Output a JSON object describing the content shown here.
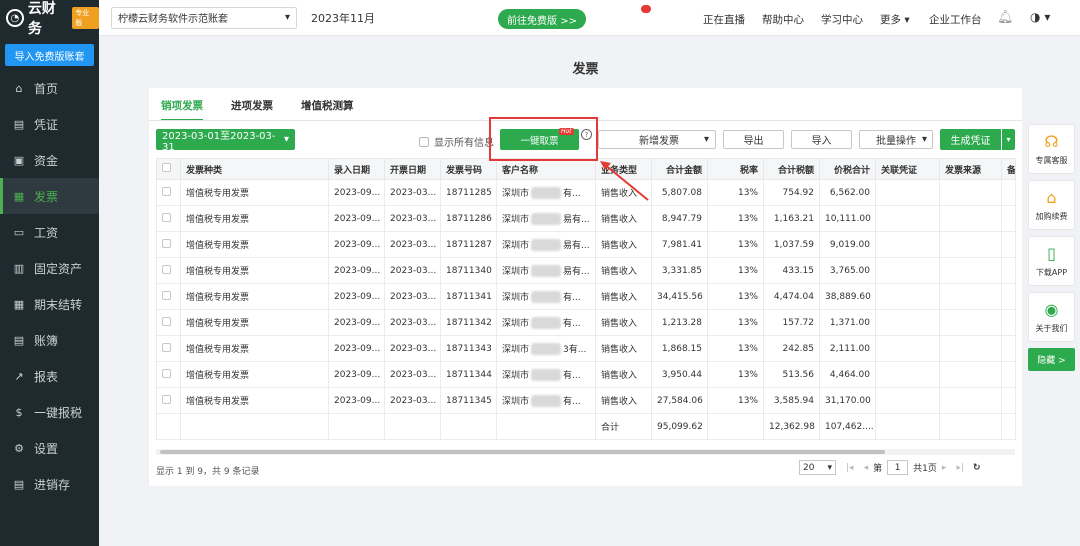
{
  "app": {
    "logo_text": "云财务",
    "edition_badge": "专业版"
  },
  "sidebar": {
    "import_button": "导入免费版账套",
    "items": [
      {
        "label": "首页",
        "icon": "home-icon",
        "glyph": "⌂",
        "active": false
      },
      {
        "label": "凭证",
        "icon": "voucher-icon",
        "glyph": "▤",
        "active": false
      },
      {
        "label": "资金",
        "icon": "fund-icon",
        "glyph": "▣",
        "active": false
      },
      {
        "label": "发票",
        "icon": "invoice-icon",
        "glyph": "▦",
        "active": true
      },
      {
        "label": "工资",
        "icon": "salary-icon",
        "glyph": "▭",
        "active": false
      },
      {
        "label": "固定资产",
        "icon": "asset-icon",
        "glyph": "▥",
        "active": false
      },
      {
        "label": "期末结转",
        "icon": "period-end-icon",
        "glyph": "▦",
        "active": false
      },
      {
        "label": "账簿",
        "icon": "ledger-icon",
        "glyph": "▤",
        "active": false
      },
      {
        "label": "报表",
        "icon": "report-icon",
        "glyph": "↗",
        "active": false
      },
      {
        "label": "一键报税",
        "icon": "tax-icon",
        "glyph": "$",
        "active": false
      },
      {
        "label": "设置",
        "icon": "settings-icon",
        "glyph": "⚙",
        "active": false
      },
      {
        "label": "进销存",
        "icon": "inventory-icon",
        "glyph": "▤",
        "active": false
      }
    ]
  },
  "topbar": {
    "account": "柠檬云财务软件示范账套",
    "period": "2023年11月",
    "free_button": "前往免费版 >>",
    "links": [
      "正在直播",
      "帮助中心",
      "学习中心",
      "更多",
      "企业工作台"
    ]
  },
  "page": {
    "title": "发票"
  },
  "tabs": [
    "销项发票",
    "进项发票",
    "增值税测算"
  ],
  "toolbar": {
    "date_range": "2023-03-01至2023-03-31",
    "show_all": "显示所有信息",
    "fetch_button": "一键取票",
    "hot_badge": "Hot",
    "new_invoice": "新增发票",
    "export": "导出",
    "import": "导入",
    "batch": "批量操作",
    "generate": "生成凭证"
  },
  "table": {
    "columns": [
      "发票种类",
      "录入日期",
      "开票日期",
      "发票号码",
      "客户名称",
      "业务类型",
      "合计金额",
      "税率",
      "合计税额",
      "价税合计",
      "关联凭证",
      "发票来源",
      "备"
    ],
    "rows": [
      [
        "增值税专用发票",
        "2023-09...",
        "2023-03...",
        "18711285",
        "深圳市",
        "有...",
        "销售收入",
        "5,807.08",
        "13%",
        "754.92",
        "6,562.00"
      ],
      [
        "增值税专用发票",
        "2023-09...",
        "2023-03...",
        "18711286",
        "深圳市",
        "易有...",
        "销售收入",
        "8,947.79",
        "13%",
        "1,163.21",
        "10,111.00"
      ],
      [
        "增值税专用发票",
        "2023-09...",
        "2023-03...",
        "18711287",
        "深圳市",
        "易有...",
        "销售收入",
        "7,981.41",
        "13%",
        "1,037.59",
        "9,019.00"
      ],
      [
        "增值税专用发票",
        "2023-09...",
        "2023-03...",
        "18711340",
        "深圳市",
        "易有...",
        "销售收入",
        "3,331.85",
        "13%",
        "433.15",
        "3,765.00"
      ],
      [
        "增值税专用发票",
        "2023-09...",
        "2023-03...",
        "18711341",
        "深圳市",
        "有...",
        "销售收入",
        "34,415.56",
        "13%",
        "4,474.04",
        "38,889.60"
      ],
      [
        "增值税专用发票",
        "2023-09...",
        "2023-03...",
        "18711342",
        "深圳市",
        "有...",
        "销售收入",
        "1,213.28",
        "13%",
        "157.72",
        "1,371.00"
      ],
      [
        "增值税专用发票",
        "2023-09...",
        "2023-03...",
        "18711343",
        "深圳市",
        "3有...",
        "销售收入",
        "1,868.15",
        "13%",
        "242.85",
        "2,111.00"
      ],
      [
        "增值税专用发票",
        "2023-09...",
        "2023-03...",
        "18711344",
        "深圳市",
        "有...",
        "销售收入",
        "3,950.44",
        "13%",
        "513.56",
        "4,464.00"
      ],
      [
        "增值税专用发票",
        "2023-09...",
        "2023-03...",
        "18711345",
        "深圳市",
        "有...",
        "销售收入",
        "27,584.06",
        "13%",
        "3,585.94",
        "31,170.00"
      ]
    ],
    "total": {
      "label": "合计",
      "amount": "95,099.62",
      "tax": "12,362.98",
      "sum": "107,462...."
    }
  },
  "footer": {
    "summary": "显示 1 到 9，共 9 条记录",
    "page_size": "20",
    "page_prefix": "第",
    "page": "1",
    "page_total": "共1页"
  },
  "rail": [
    {
      "label": "专属客服",
      "icon": "headset-icon",
      "glyph": "☊",
      "color": "#f0a020"
    },
    {
      "label": "加购续费",
      "icon": "cart-icon",
      "glyph": "⌂",
      "color": "#f0a020"
    },
    {
      "label": "下载APP",
      "icon": "phone-icon",
      "glyph": "▯",
      "color": "#2eaa4e"
    },
    {
      "label": "关于我们",
      "icon": "wechat-icon",
      "glyph": "◉",
      "color": "#2eaa4e"
    }
  ],
  "rail_hide": "隐藏 >"
}
